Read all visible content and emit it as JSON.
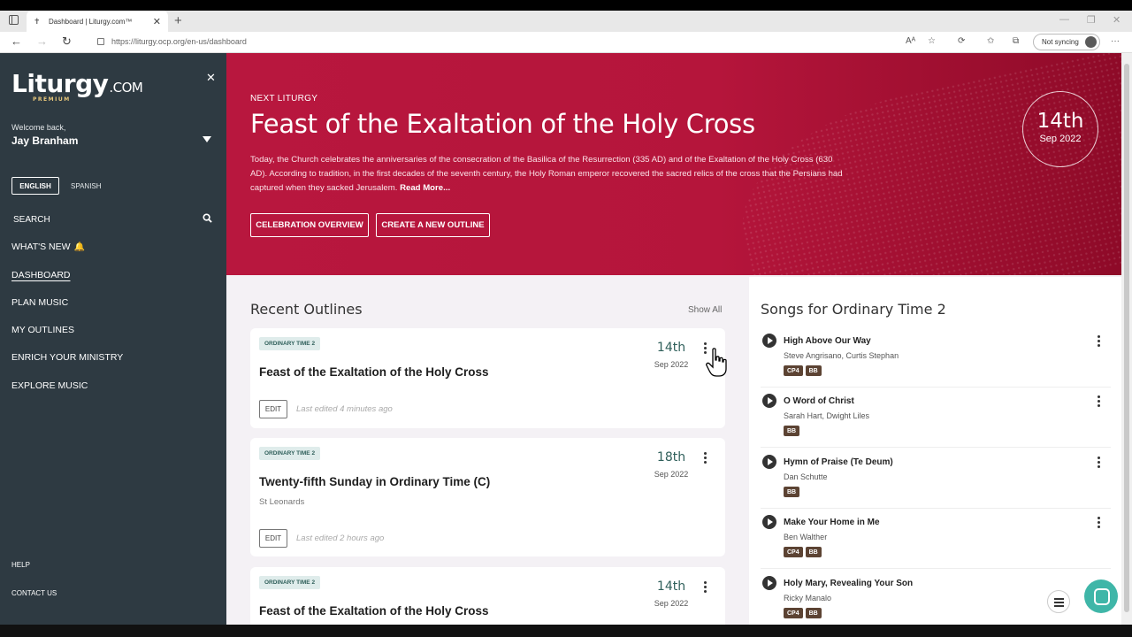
{
  "browser": {
    "tab_title": "Dashboard | Liturgy.com™",
    "url": "https://liturgy.ocp.org/en-us/dashboard",
    "sync_label": "Not syncing"
  },
  "sidebar": {
    "logo_main": "Liturgy",
    "logo_suffix": ".COM",
    "logo_premium": "PREMIUM",
    "welcome": "Welcome back,",
    "user_name": "Jay Branham",
    "lang_english": "ENGLISH",
    "lang_spanish": "SPANISH",
    "search_label": "SEARCH",
    "nav": {
      "whats_new": "WHAT'S NEW",
      "dashboard": "DASHBOARD",
      "plan_music": "PLAN MUSIC",
      "my_outlines": "MY OUTLINES",
      "enrich": "ENRICH YOUR MINISTRY",
      "explore": "EXPLORE MUSIC"
    },
    "help": "HELP",
    "contact": "CONTACT US"
  },
  "hero": {
    "label": "NEXT LITURGY",
    "title": "Feast of the Exaltation of the Holy Cross",
    "description": "Today, the Church celebrates the anniversaries of the consecration of the Basilica of the Resurrection (335 AD) and of the Exaltation of the Holy Cross (630 AD). According to tradition, in the first decades of the seventh century, the Holy Roman emperor recovered the sacred relics of the cross that the Persians had captured when they sacked Jerusalem.",
    "read_more": "Read More...",
    "btn_overview": "CELEBRATION OVERVIEW",
    "btn_create": "CREATE A NEW OUTLINE",
    "date_day": "14th",
    "date_month": "Sep 2022"
  },
  "recent": {
    "heading": "Recent Outlines",
    "show_all": "Show All",
    "edit_label": "EDIT",
    "cards": [
      {
        "tag": "ORDINARY TIME 2",
        "title": "Feast of the Exaltation of the Holy Cross",
        "subtitle": "",
        "day": "14th",
        "month": "Sep 2022",
        "edited": "Last edited 4 minutes ago"
      },
      {
        "tag": "ORDINARY TIME 2",
        "title": "Twenty-fifth Sunday in Ordinary Time (C)",
        "subtitle": "St Leonards",
        "day": "18th",
        "month": "Sep 2022",
        "edited": "Last edited 2 hours ago"
      },
      {
        "tag": "ORDINARY TIME 2",
        "title": "Feast of the Exaltation of the Holy Cross",
        "subtitle": "",
        "day": "14th",
        "month": "Sep 2022",
        "edited": ""
      }
    ]
  },
  "songs": {
    "heading": "Songs for Ordinary Time 2",
    "items": [
      {
        "title": "High Above Our Way",
        "artist": "Steve Angrisano, Curtis Stephan",
        "badges": [
          "CP4",
          "BB"
        ]
      },
      {
        "title": "O Word of Christ",
        "artist": "Sarah Hart, Dwight Liles",
        "badges": [
          "BB"
        ]
      },
      {
        "title": "Hymn of Praise (Te Deum)",
        "artist": "Dan Schutte",
        "badges": [
          "BB"
        ]
      },
      {
        "title": "Make Your Home in Me",
        "artist": "Ben Walther",
        "badges": [
          "CP4",
          "BB"
        ]
      },
      {
        "title": "Holy Mary, Revealing Your Son",
        "artist": "Ricky Manalo",
        "badges": [
          "CP4",
          "BB"
        ]
      }
    ]
  },
  "colors": {
    "hero": "#b5153b",
    "sidebar": "#2e3a42",
    "accent_teal": "#2f5f5a",
    "chat_fab": "#3fb6a8"
  }
}
